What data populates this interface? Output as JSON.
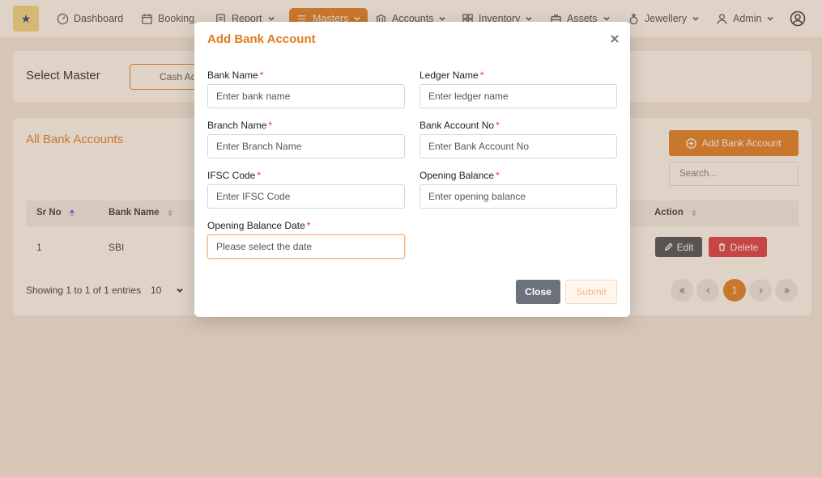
{
  "nav": {
    "items": [
      {
        "label": "Dashboard",
        "icon": "dashboard-icon"
      },
      {
        "label": "Booking",
        "icon": "calendar-icon"
      },
      {
        "label": "Report",
        "icon": "report-icon"
      },
      {
        "label": "Masters",
        "icon": "list-icon",
        "active": true
      },
      {
        "label": "Accounts",
        "icon": "bank-icon"
      },
      {
        "label": "Inventory",
        "icon": "grid-icon"
      },
      {
        "label": "Assets",
        "icon": "briefcase-icon"
      },
      {
        "label": "Jewellery",
        "icon": "ring-icon"
      },
      {
        "label": "Admin",
        "icon": "user-icon"
      }
    ]
  },
  "select_master": {
    "title": "Select Master",
    "cash_button": "Cash Ac"
  },
  "bank_list": {
    "title": "All Bank Accounts",
    "add_button": "Add Bank Account",
    "search_placeholder": "Search...",
    "columns": [
      "Sr No",
      "Bank Name",
      "Action"
    ],
    "rows": [
      {
        "sr_no": "1",
        "bank_name": "SBI"
      }
    ],
    "edit_label": "Edit",
    "delete_label": "Delete",
    "entries_text": "Showing 1 to 1 of 1 entries",
    "page_size": "10",
    "current_page": "1"
  },
  "modal": {
    "title": "Add Bank Account",
    "fields": {
      "bank_name": {
        "label": "Bank Name",
        "placeholder": "Enter bank name"
      },
      "ledger_name": {
        "label": "Ledger Name",
        "placeholder": "Enter ledger name"
      },
      "branch_name": {
        "label": "Branch Name",
        "placeholder": "Enter Branch Name"
      },
      "bank_account_no": {
        "label": "Bank Account No",
        "placeholder": "Enter Bank Account No"
      },
      "ifsc_code": {
        "label": "IFSC Code",
        "placeholder": "Enter IFSC Code"
      },
      "opening_balance": {
        "label": "Opening Balance",
        "placeholder": "Enter opening balance"
      },
      "opening_balance_date": {
        "label": "Opening Balance Date",
        "placeholder": "Please select the date"
      }
    },
    "required_mark": "*",
    "close_label": "Close",
    "submit_label": "Submit"
  },
  "colors": {
    "accent": "#e07b22",
    "danger": "#dc3545",
    "dark_button": "#3f4a5a",
    "close_button": "#6c727c"
  }
}
